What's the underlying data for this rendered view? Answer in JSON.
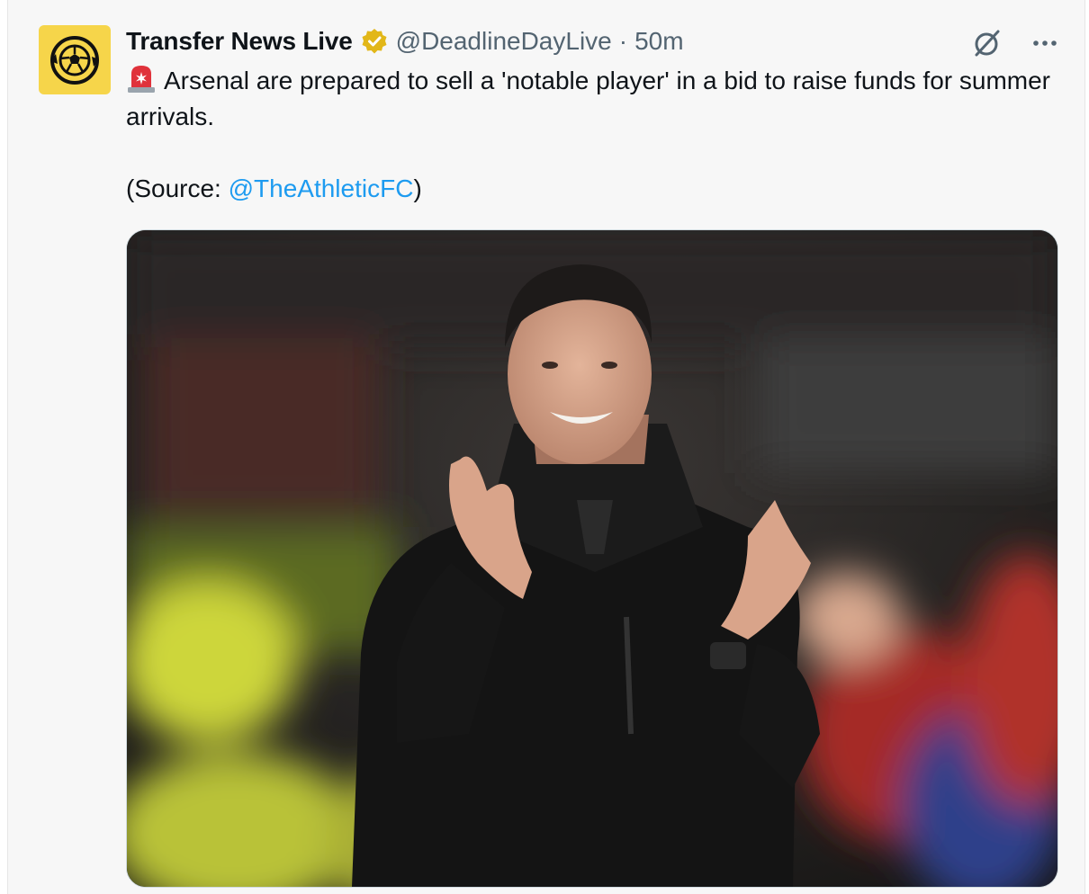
{
  "tweet": {
    "author_name": "Transfer News Live",
    "handle": "@DeadlineDayLive",
    "separator": "·",
    "time": "50m",
    "text_line1": "Arsenal are prepared to sell a 'notable player' in a bid to raise funds for summer arrivals.",
    "source_prefix": "(Source: ",
    "source_mention": "@TheAthleticFC",
    "source_suffix": ")",
    "emoji": "siren-icon",
    "verified": true
  },
  "icons": {
    "avatar": "football-logo-icon",
    "verified_badge": "verified-badge-icon",
    "grok": "grok-icon",
    "more": "more-icon"
  },
  "colors": {
    "avatar_bg": "#f6d54a",
    "badge": "#e2b719",
    "link": "#1d9bf0",
    "muted": "#536471"
  },
  "media": {
    "kind": "photo"
  }
}
